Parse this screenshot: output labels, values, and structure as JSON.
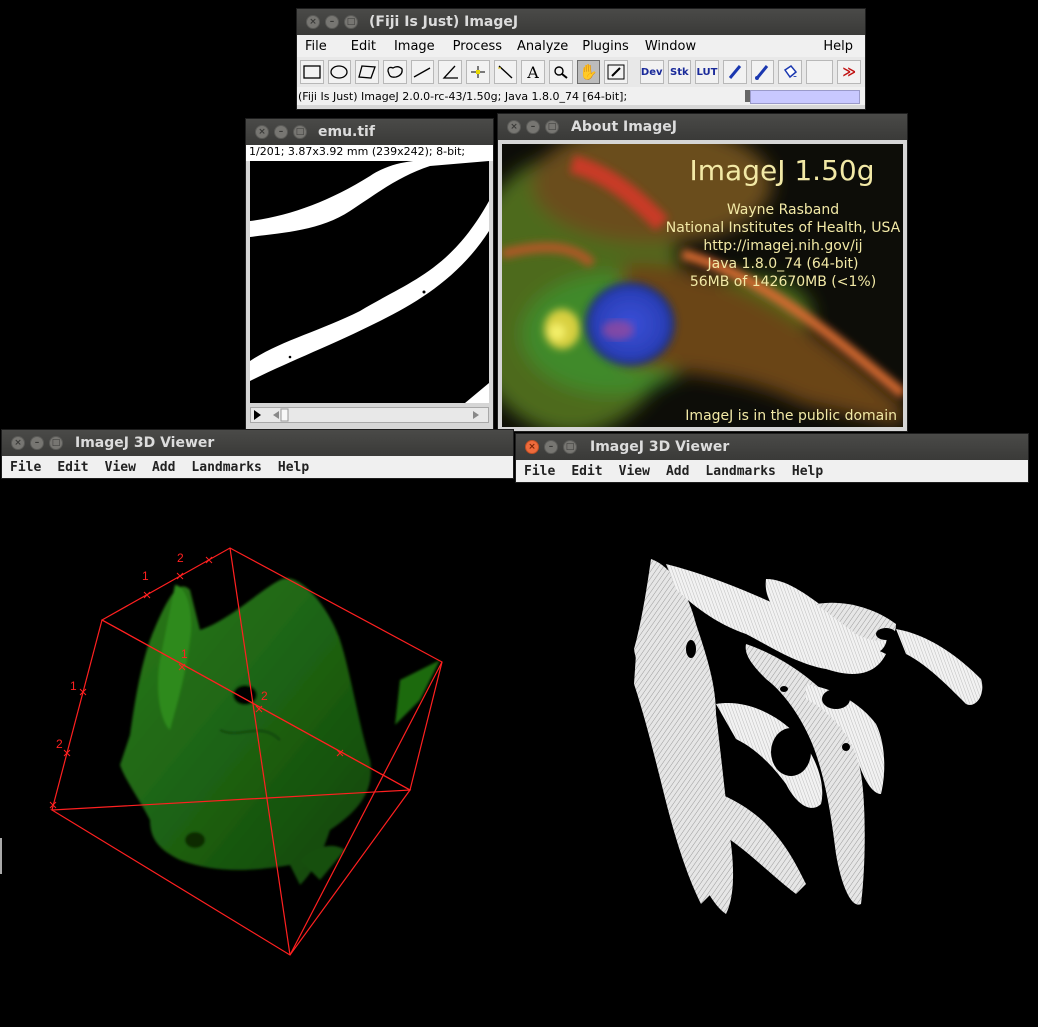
{
  "main_window": {
    "title": "(Fiji Is Just) ImageJ",
    "menu": [
      "File",
      "Edit",
      "Image",
      "Process",
      "Analyze",
      "Plugins",
      "Window",
      "Help"
    ],
    "tools": [
      "rectangle-tool",
      "oval-tool",
      "polygon-tool",
      "freehand-tool",
      "line-tool",
      "angle-tool",
      "point-tool",
      "wand-tool",
      "text-tool",
      "magnifier-tool",
      "hand-tool",
      "color-picker-tool",
      "Dev",
      "Stk",
      "LUT",
      "pencil-tool",
      "brush-tool",
      "flood-fill-tool",
      "empty-slot",
      "more-tools"
    ],
    "status": "(Fiji Is Just) ImageJ 2.0.0-rc-43/1.50g; Java 1.8.0_74 [64-bit];"
  },
  "emu_window": {
    "title": "emu.tif",
    "info": "1/201; 3.87x3.92 mm (239x242); 8-bit;"
  },
  "about_window": {
    "title": "About ImageJ",
    "heading": "ImageJ 1.50g",
    "lines": [
      "Wayne Rasband",
      "National Institutes of Health, USA",
      "http://imagej.nih.gov/ij",
      "Java 1.8.0_74 (64-bit)",
      "56MB of 142670MB (<1%)"
    ],
    "footer": "ImageJ is in the public domain"
  },
  "viewer_left": {
    "title": "ImageJ 3D Viewer",
    "menu": [
      "File",
      "Edit",
      "View",
      "Add",
      "Landmarks",
      "Help"
    ],
    "landmark_labels": [
      "1",
      "2",
      "1",
      "1",
      "2",
      "2"
    ]
  },
  "viewer_right": {
    "title": "ImageJ 3D Viewer",
    "menu": [
      "File",
      "Edit",
      "View",
      "Add",
      "Landmarks",
      "Help"
    ]
  },
  "colors": {
    "titlebar": "#3c3b37",
    "about_text": "#f2e9a6",
    "bbox": "#ff2020",
    "surface_green": "#1f6a12"
  }
}
